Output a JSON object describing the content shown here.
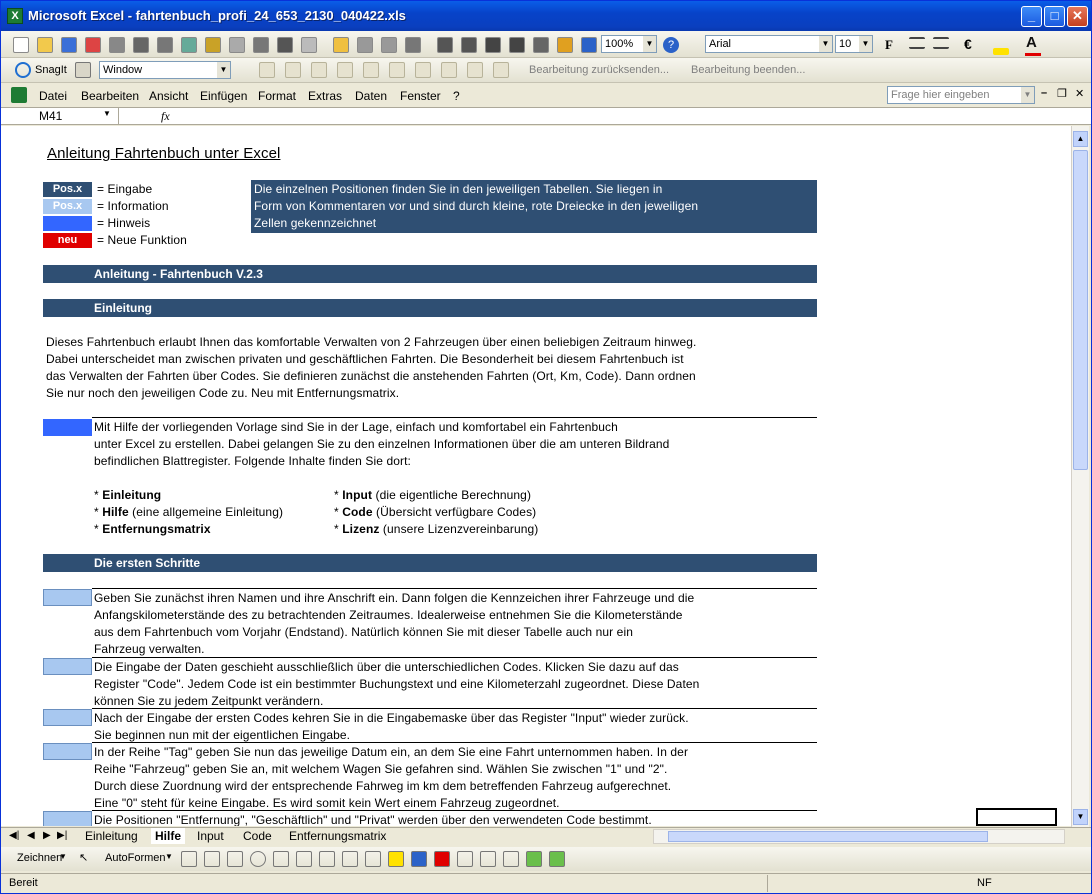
{
  "window": {
    "title": "Microsoft Excel - fahrtenbuch_profi_24_653_2130_040422.xls"
  },
  "toolbar": {
    "zoom": "100%",
    "font": "Arial",
    "size": "10",
    "bold": "F",
    "euro": "€",
    "snagit": "SnagIt",
    "window_combo": "Window",
    "review_reply": "Bearbeitung zurücksenden...",
    "review_end": "Bearbeitung beenden..."
  },
  "menu": {
    "items": [
      "Datei",
      "Bearbeiten",
      "Ansicht",
      "Einfügen",
      "Format",
      "Extras",
      "Daten",
      "Fenster",
      "?"
    ],
    "help_placeholder": "Frage hier eingeben"
  },
  "formula": {
    "cell_ref": "M41",
    "fx": "fx"
  },
  "sheet": {
    "title": "Anleitung Fahrtenbuch unter Excel",
    "legend": [
      {
        "tag": "Pos.x",
        "text": "= Eingabe",
        "color": "#2f4f73"
      },
      {
        "tag": "Pos.x",
        "text": "= Information",
        "color": "#a8c8f0"
      },
      {
        "tag": "",
        "text": "= Hinweis",
        "color": "#3366ff"
      },
      {
        "tag": "neu",
        "text": "= Neue Funktion",
        "color": "#e00000"
      }
    ],
    "info_box": [
      "Die einzelnen Positionen finden Sie in den jeweiligen Tabellen. Sie liegen in",
      "Form von Kommentaren vor und sind durch kleine, rote Dreiecke in den jeweiligen",
      "Zellen gekennzeichnet"
    ],
    "band1": "Anleitung - Fahrtenbuch V.2.3",
    "band2": "Einleitung",
    "intro": [
      "Dieses Fahrtenbuch erlaubt Ihnen das komfortable Verwalten von 2 Fahrzeugen über einen beliebigen Zeitraum hinweg.",
      "Dabei unterscheidet man zwischen privaten und geschäftlichen Fahrten. Die Besonderheit bei diesem Fahrtenbuch ist",
      "das Verwalten der Fahrten über Codes. Sie definieren zunächst die anstehenden Fahrten (Ort, Km, Code). Dann ordnen",
      "Sie nur noch den jeweiligen Code zu. Neu mit Entfernungsmatrix."
    ],
    "hint": [
      "Mit Hilfe der vorliegenden Vorlage sind Sie in der Lage, einfach und komfortabel ein Fahrtenbuch",
      "unter Excel zu erstellen. Dabei gelangen Sie zu den einzelnen Informationen über die am unteren Bildrand",
      "befindlichen Blattregister. Folgende Inhalte finden Sie dort:"
    ],
    "contents_left": [
      {
        "bold": "Einleitung",
        "rest": ""
      },
      {
        "bold": "Hilfe",
        "rest": " (eine allgemeine Einleitung)"
      },
      {
        "bold": "Entfernungsmatrix",
        "rest": ""
      }
    ],
    "contents_right": [
      {
        "bold": "Input",
        "rest": " (die eigentliche Berechnung)"
      },
      {
        "bold": "Code",
        "rest": " (Übersicht verfügbare Codes)"
      },
      {
        "bold": "Lizenz",
        "rest": " (unsere Lizenzvereinbarung)"
      }
    ],
    "band3": "Die ersten Schritte",
    "steps": [
      [
        "Geben Sie zunächst ihren Namen und ihre Anschrift ein. Dann folgen die Kennzeichen ihrer Fahrzeuge und die",
        "Anfangskilometerstände des zu betrachtenden Zeitraumes. Idealerweise entnehmen Sie die Kilometerstände",
        "aus dem Fahrtenbuch vom Vorjahr (Endstand). Natürlich können Sie mit dieser Tabelle auch nur ein",
        "Fahrzeug verwalten."
      ],
      [
        "Die Eingabe der Daten geschieht ausschließlich über die unterschiedlichen Codes. Klicken Sie dazu auf das",
        "Register \"Code\". Jedem Code ist ein bestimmter Buchungstext und eine Kilometerzahl zugeordnet. Diese Daten",
        "können Sie zu jedem Zeitpunkt verändern."
      ],
      [
        "Nach der Eingabe der ersten Codes kehren Sie in die Eingabemaske über das Register \"Input\" wieder zurück.",
        " Sie beginnen nun mit der eigentlichen Eingabe."
      ],
      [
        "In der Reihe \"Tag\" geben Sie nun das jeweilige Datum ein, an dem Sie eine Fahrt unternommen haben. In der",
        "Reihe \"Fahrzeug\" geben Sie an, mit welchem Wagen Sie gefahren sind. Wählen Sie zwischen \"1\" und \"2\".",
        "Durch diese Zuordnung wird der entsprechende Fahrweg im km dem betreffenden Fahrzeug aufgerechnet.",
        "Eine \"0\" steht für keine Eingabe. Es wird somit kein Wert einem Fahrzeug zugeordnet."
      ],
      [
        "Die Positionen \"Entfernung\", \"Geschäftlich\" und \"Privat\" werden über den verwendeten Code bestimmt."
      ]
    ]
  },
  "tabs": [
    "Einleitung",
    "Hilfe",
    "Input",
    "Code",
    "Entfernungsmatrix"
  ],
  "drawbar": {
    "draw": "Zeichnen",
    "autoshapes": "AutoFormen"
  },
  "status": {
    "left": "Bereit",
    "nf": "NF"
  }
}
